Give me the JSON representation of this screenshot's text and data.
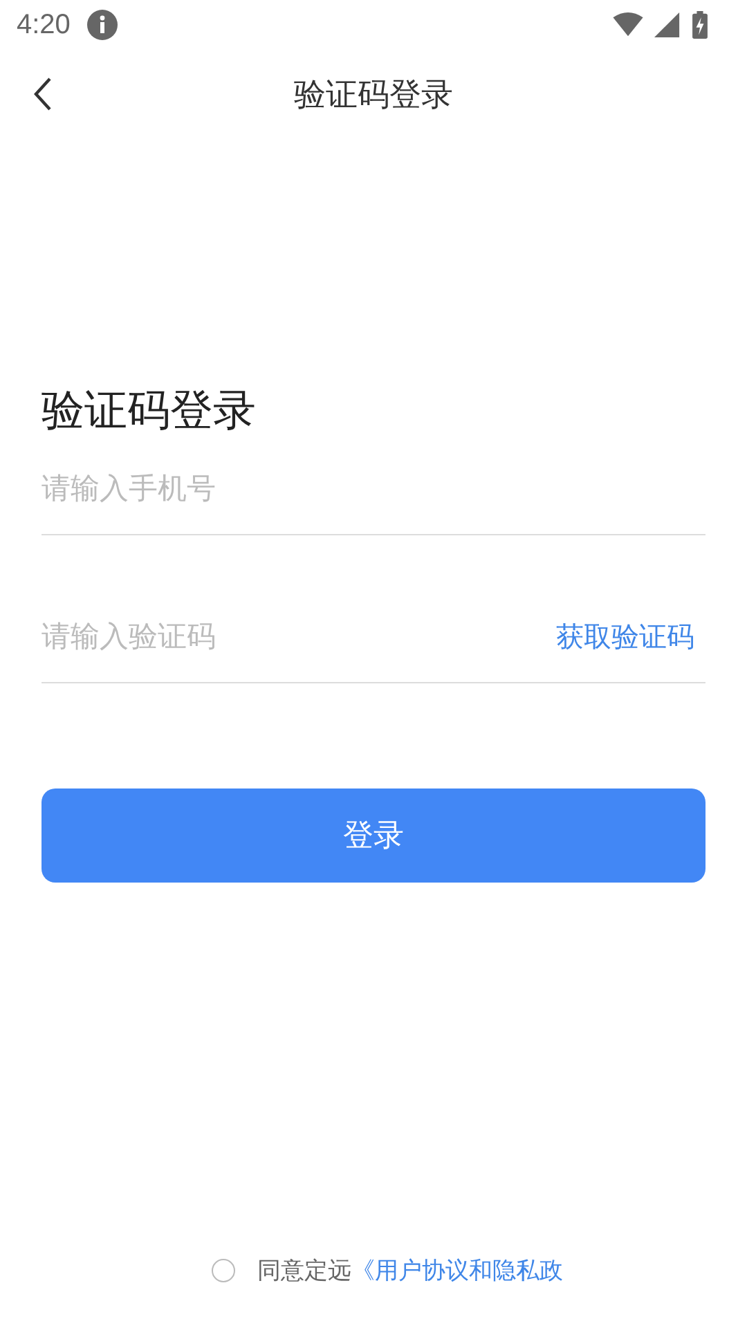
{
  "status_bar": {
    "time": "4:20"
  },
  "nav_bar": {
    "title": "验证码登录"
  },
  "heading": "验证码登录",
  "phone_field": {
    "placeholder": "请输入手机号"
  },
  "code_field": {
    "placeholder": "请输入验证码",
    "action": "获取验证码"
  },
  "login_button": "登录",
  "agreement": {
    "checked": false,
    "text": "同意定远",
    "link": "《用户协议和隐私政"
  }
}
